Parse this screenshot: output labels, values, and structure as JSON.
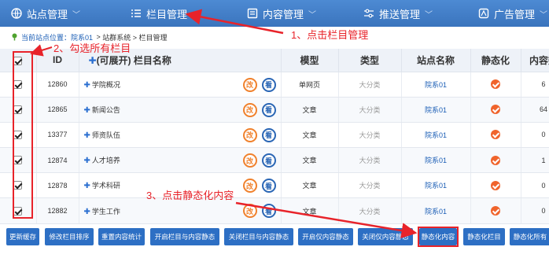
{
  "nav": {
    "items": [
      {
        "label": "站点管理",
        "icon": "globe-icon"
      },
      {
        "label": "栏目管理",
        "icon": "list-icon"
      },
      {
        "label": "内容管理",
        "icon": "document-icon"
      },
      {
        "label": "推送管理",
        "icon": "sliders-icon"
      },
      {
        "label": "广告管理",
        "icon": "ad-icon"
      }
    ]
  },
  "breadcrumb": {
    "location_label": "当前站点位置：院系01",
    "separator": " > ",
    "path": "站群系统 > 栏目管理"
  },
  "table": {
    "headers": {
      "id": "ID",
      "name": "(可展开) 栏目名称",
      "model": "模型",
      "type": "类型",
      "site": "站点名称",
      "static": "静态化",
      "count": "内容数"
    },
    "rows": [
      {
        "id": "12860",
        "name": "学院概况",
        "model": "单网页",
        "type": "大分类",
        "site": "院系01",
        "count": "6"
      },
      {
        "id": "12865",
        "name": "新闻公告",
        "model": "文章",
        "type": "大分类",
        "site": "院系01",
        "count": "64"
      },
      {
        "id": "13377",
        "name": "师资队伍",
        "model": "文章",
        "type": "大分类",
        "site": "院系01",
        "count": "0"
      },
      {
        "id": "12874",
        "name": "人才培养",
        "model": "文章",
        "type": "大分类",
        "site": "院系01",
        "count": "1"
      },
      {
        "id": "12878",
        "name": "学术科研",
        "model": "文章",
        "type": "大分类",
        "site": "院系01",
        "count": "0"
      },
      {
        "id": "12882",
        "name": "学生工作",
        "model": "文章",
        "type": "大分类",
        "site": "院系01",
        "count": "0"
      }
    ]
  },
  "buttons": [
    "更新缓存",
    "修改栏目排序",
    "重置内容统计",
    "开启栏目与内容静态",
    "关闭栏目与内容静态",
    "开启仅内容静态",
    "关闭仅内容静态",
    "静态化内容",
    "静态化栏目",
    "静态化所有"
  ],
  "annotations": {
    "step1": "1、点击栏目管理",
    "step2": "2、勾选所有栏目",
    "step3": "3、点击静态化内容"
  },
  "colors": {
    "nav": "#3a74bd",
    "accent": "#e8232a",
    "button": "#2d6fc4"
  }
}
